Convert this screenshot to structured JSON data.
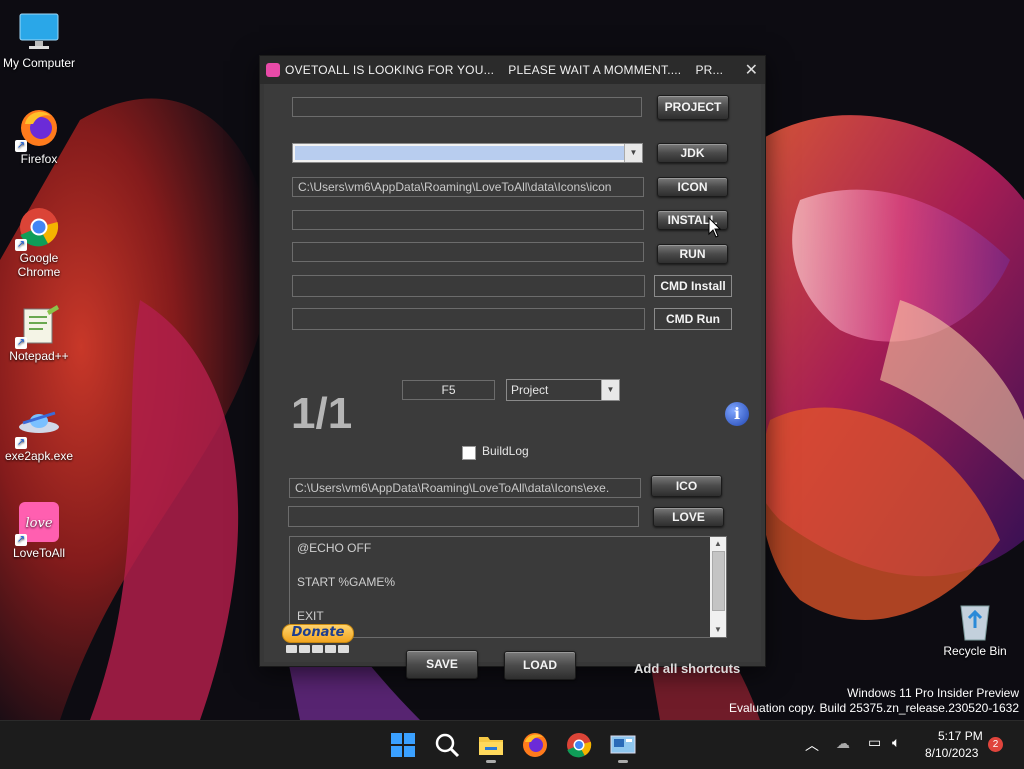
{
  "desktop": {
    "icons": [
      {
        "label": "My Computer",
        "icon": "monitor-icon"
      },
      {
        "label": "Firefox",
        "icon": "firefox-icon"
      },
      {
        "label": "Google Chrome",
        "icon": "chrome-icon"
      },
      {
        "label": "Notepad++",
        "icon": "notepadpp-icon"
      },
      {
        "label": "exe2apk.exe",
        "icon": "ufo-icon"
      },
      {
        "label": "LoveToAll",
        "icon": "love-icon"
      },
      {
        "label": "Recycle Bin",
        "icon": "recycle-bin-icon"
      }
    ],
    "watermark_line1": "Windows 11 Pro Insider Preview",
    "watermark_line2": "Evaluation copy. Build 25375.zn_release.230520-1632"
  },
  "window": {
    "title": "OVETOALL IS LOOKING FOR YOU...    PLEASE WAIT A MOMMENT....    PR...",
    "close_label": "✕",
    "project_path": "",
    "project_button": "PROJECT",
    "jdk_value": "",
    "jdk_button": "JDK",
    "icon_path": "C:\\Users\\vm6\\AppData\\Roaming\\LoveToAll\\data\\Icons\\icon",
    "icon_button": "ICON",
    "install_path": "",
    "install_button": "INSTALL",
    "run_path": "",
    "run_button": "RUN",
    "cmd_install_path": "",
    "cmd_install_button": "CMD Install",
    "cmd_run_path": "",
    "cmd_run_button": "CMD Run",
    "counter": "1/1",
    "hotkey": "F5",
    "mode_select": "Project",
    "buildlog_label": "BuildLog",
    "buildlog_checked": false,
    "ico_path": "C:\\Users\\vm6\\AppData\\Roaming\\LoveToAll\\data\\Icons\\exe.",
    "ico_button": "ICO",
    "love_path": "",
    "love_button": "LOVE",
    "script_lines": [
      "@ECHO OFF",
      "START %GAME%",
      "EXIT"
    ],
    "donate_label": "Donate",
    "save_button": "SAVE",
    "load_button": "LOAD",
    "shortcuts_label": "Add all shortcuts"
  },
  "taskbar": {
    "time": "5:17 PM",
    "date": "8/10/2023",
    "notification_count": "2"
  },
  "colors": {
    "window_bg": "#3b3b3b",
    "titlebar_bg": "#2b2b2b",
    "selection": "#b8cdef",
    "taskbar_bg": "#1c1c1c",
    "notification_badge": "#e0443c"
  }
}
